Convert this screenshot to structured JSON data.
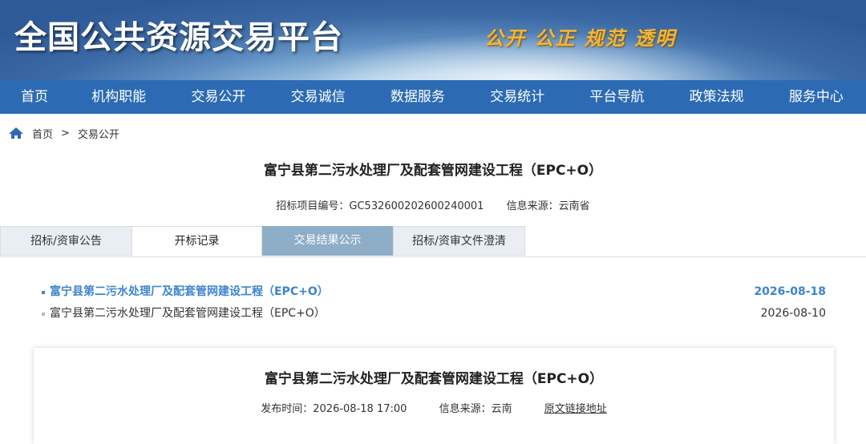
{
  "header": {
    "site_title": "全国公共资源交易平台",
    "slogan": "公开 公正 规范 透明"
  },
  "nav": {
    "items": [
      "首页",
      "机构职能",
      "交易公开",
      "交易诚信",
      "数据服务",
      "交易统计",
      "平台导航",
      "政策法规",
      "服务中心"
    ]
  },
  "breadcrumb": {
    "home": "首页",
    "separator": ">",
    "current": "交易公开"
  },
  "project": {
    "title": "富宁县第二污水处理厂及配套管网建设工程（EPC+O）",
    "code_text": "招标项目编号：GC532600202600240001",
    "source_text": "信息来源：云南省"
  },
  "tabs": {
    "items": [
      "招标/资审公告",
      "开标记录",
      "交易结果公示",
      "招标/资审文件澄清"
    ]
  },
  "list": {
    "rows": [
      {
        "name": "富宁县第二污水处理厂及配套管网建设工程（EPC+O）",
        "date": "2026-08-18"
      },
      {
        "name": "富宁县第二污水处理厂及配套管网建设工程（EPC+O）",
        "date": "2026-08-10"
      }
    ]
  },
  "detail": {
    "title": "富宁县第二污水处理厂及配套管网建设工程（EPC+O）",
    "publish_time": "发布时间：2026-08-18 17:00",
    "source": "信息来源：云南",
    "link_text": "原文链接地址"
  },
  "colors": {
    "nav_bg": "#2c6bb3",
    "active_tab": "#8eaec8",
    "active_link": "#3d84cf"
  }
}
